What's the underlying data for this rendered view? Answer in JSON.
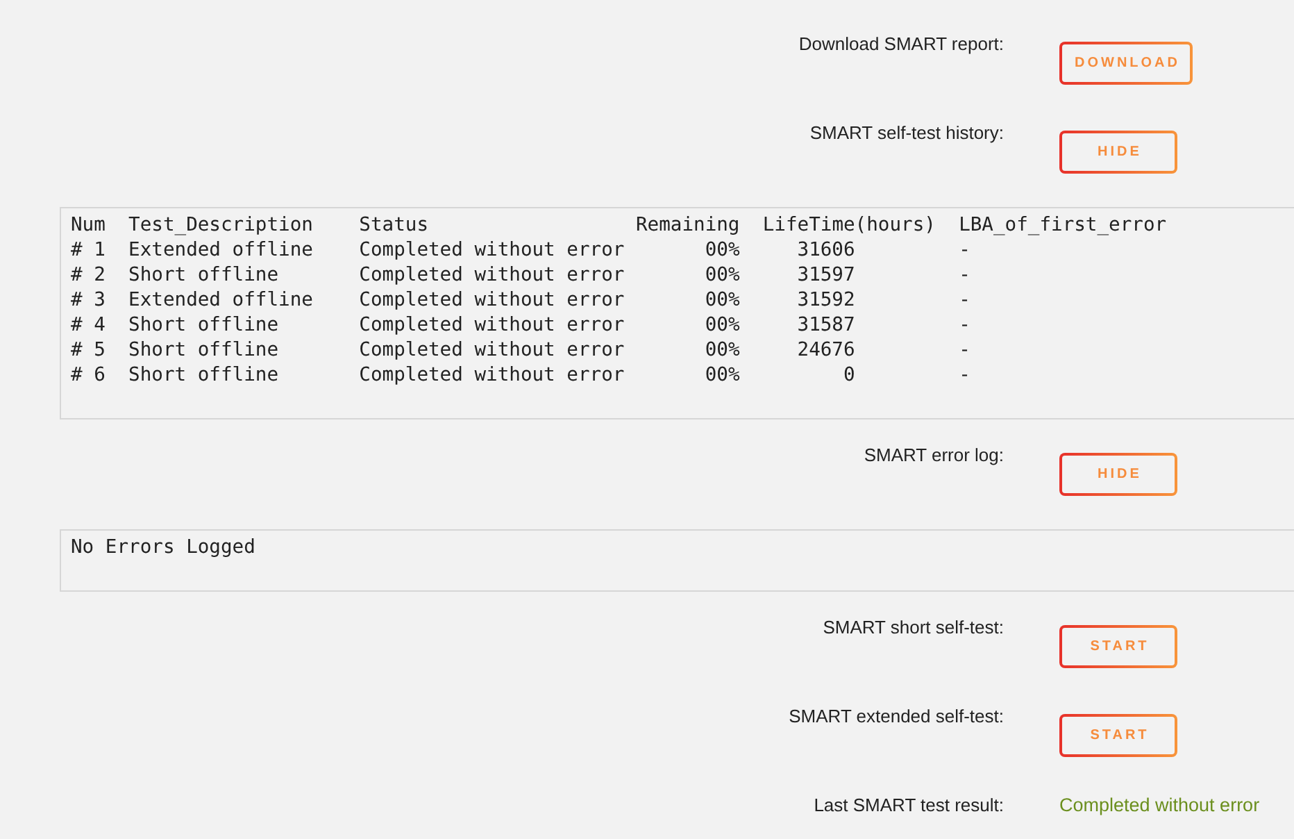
{
  "sections": [
    {
      "kind": "action",
      "label": "Download SMART report:",
      "button": "DOWNLOAD"
    },
    {
      "kind": "action",
      "label": "SMART self-test history:",
      "button": "HIDE"
    },
    {
      "kind": "table",
      "columns": [
        "Num",
        "Test_Description",
        "Status",
        "Remaining",
        "LifeTime(hours)",
        "LBA_of_first_error"
      ],
      "rows": [
        [
          "# 1",
          "Extended offline",
          "Completed without error",
          "00%",
          "31606",
          "-"
        ],
        [
          "# 2",
          "Short offline",
          "Completed without error",
          "00%",
          "31597",
          "-"
        ],
        [
          "# 3",
          "Extended offline",
          "Completed without error",
          "00%",
          "31592",
          "-"
        ],
        [
          "# 4",
          "Short offline",
          "Completed without error",
          "00%",
          "31587",
          "-"
        ],
        [
          "# 5",
          "Short offline",
          "Completed without error",
          "00%",
          "24676",
          "-"
        ],
        [
          "# 6",
          "Short offline",
          "Completed without error",
          "00%",
          "0",
          "-"
        ]
      ]
    },
    {
      "kind": "action",
      "label": "SMART error log:",
      "button": "HIDE"
    },
    {
      "kind": "log",
      "text": "No Errors Logged"
    },
    {
      "kind": "action",
      "label": "SMART short self-test:",
      "button": "START"
    },
    {
      "kind": "action",
      "label": "SMART extended self-test:",
      "button": "START"
    },
    {
      "kind": "result",
      "label": "Last SMART test result:",
      "value": "Completed without error"
    }
  ]
}
